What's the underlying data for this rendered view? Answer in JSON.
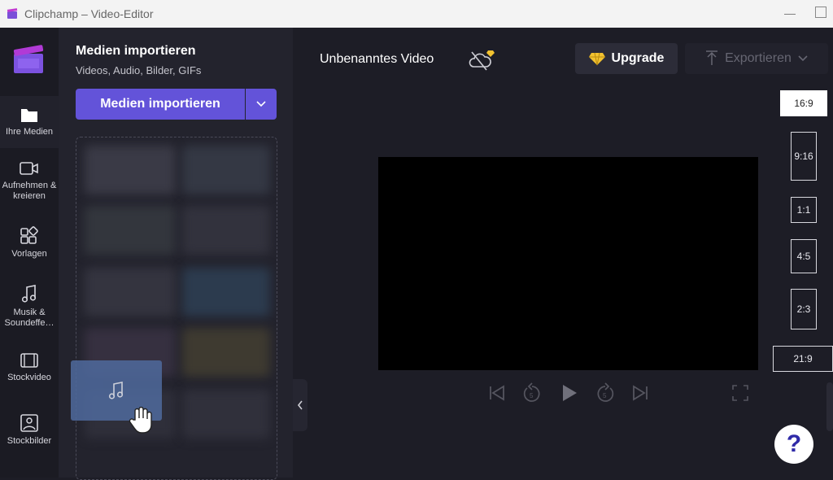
{
  "window": {
    "title": "Clipchamp – Video-Editor"
  },
  "nav": {
    "items": [
      {
        "label": "Ihre Medien",
        "icon": "folder-icon",
        "active": true
      },
      {
        "label": "Aufnehmen & kreieren",
        "icon": "camera-icon"
      },
      {
        "label": "Vorlagen",
        "icon": "templates-icon"
      },
      {
        "label": "Musik & Soundeffe…",
        "icon": "music-icon"
      },
      {
        "label": "Stockvideo",
        "icon": "film-icon"
      },
      {
        "label": "Stockbilder",
        "icon": "image-icon"
      }
    ]
  },
  "media_panel": {
    "heading": "Medien importieren",
    "subheading": "Videos, Audio, Bilder, GIFs",
    "import_button": "Medien importieren"
  },
  "editor": {
    "video_title": "Unbenanntes Video",
    "upgrade_label": "Upgrade",
    "export_label": "Exportieren"
  },
  "aspect_ratios": [
    "16:9",
    "9:16",
    "1:1",
    "4:5",
    "2:3",
    "21:9"
  ],
  "selected_ratio": "16:9",
  "help_label": "?",
  "colors": {
    "accent": "#6353d9",
    "gem": "#f2c230",
    "preview_bg": "#000000"
  }
}
